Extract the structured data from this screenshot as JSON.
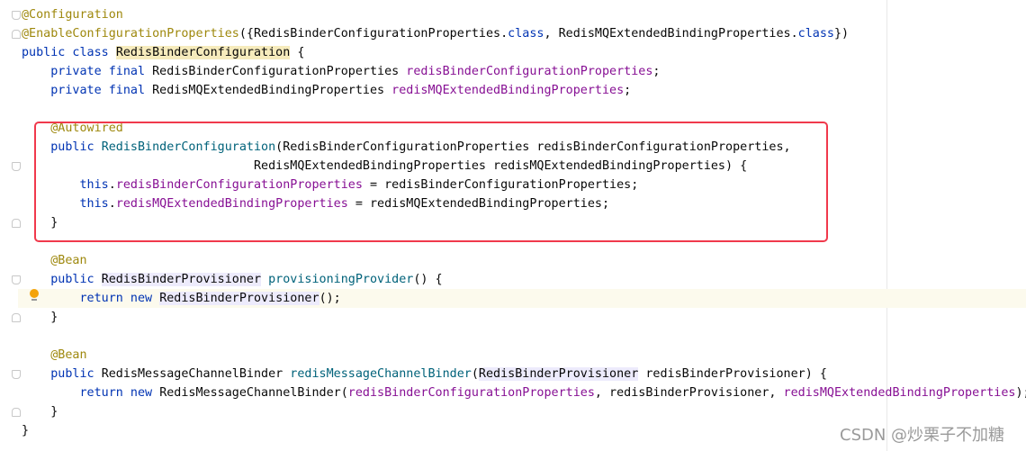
{
  "editor": {
    "lines": [
      [
        [
          "@Configuration",
          "ann"
        ]
      ],
      [
        [
          "@EnableConfigurationProperties",
          "ann"
        ],
        [
          "({RedisBinderConfigurationProperties.",
          ""
        ],
        [
          "class",
          "kw"
        ],
        [
          ", RedisMQExtendedBindingProperties.",
          ""
        ],
        [
          "class",
          "kw"
        ],
        [
          "})",
          ""
        ]
      ],
      [
        [
          "public class ",
          "kw"
        ],
        [
          "RedisBinderConfiguration",
          "hly"
        ],
        [
          " {",
          ""
        ]
      ],
      [
        [
          "    ",
          ""
        ],
        [
          "private final ",
          "kw"
        ],
        [
          "RedisBinderConfigurationProperties ",
          ""
        ],
        [
          "redisBinderConfigurationProperties",
          "fld"
        ],
        [
          ";",
          ""
        ]
      ],
      [
        [
          "    ",
          ""
        ],
        [
          "private final ",
          "kw"
        ],
        [
          "RedisMQExtendedBindingProperties ",
          ""
        ],
        [
          "redisMQExtendedBindingProperties",
          "fld"
        ],
        [
          ";",
          ""
        ]
      ],
      [],
      [
        [
          "    ",
          ""
        ],
        [
          "@Autowired",
          "ann"
        ]
      ],
      [
        [
          "    ",
          ""
        ],
        [
          "public ",
          "kw"
        ],
        [
          "RedisBinderConfiguration",
          "mth"
        ],
        [
          "(RedisBinderConfigurationProperties redisBinderConfigurationProperties,",
          ""
        ]
      ],
      [
        [
          "                                RedisMQExtendedBindingProperties redisMQExtendedBindingProperties) {",
          ""
        ]
      ],
      [
        [
          "        ",
          ""
        ],
        [
          "this",
          "kw"
        ],
        [
          ".",
          ""
        ],
        [
          "redisBinderConfigurationProperties",
          "fld"
        ],
        [
          " = redisBinderConfigurationProperties;",
          ""
        ]
      ],
      [
        [
          "        ",
          ""
        ],
        [
          "this",
          "kw"
        ],
        [
          ".",
          ""
        ],
        [
          "redisMQExtendedBindingProperties",
          "fld"
        ],
        [
          " = redisMQExtendedBindingProperties;",
          ""
        ]
      ],
      [
        [
          "    }",
          ""
        ]
      ],
      [],
      [
        [
          "    ",
          ""
        ],
        [
          "@Bean",
          "ann"
        ]
      ],
      [
        [
          "    ",
          ""
        ],
        [
          "public ",
          "kw"
        ],
        [
          "RedisBinderProvisioner",
          "hlv"
        ],
        [
          " ",
          ""
        ],
        [
          "provisioningProvider",
          "mth"
        ],
        [
          "() {",
          ""
        ]
      ],
      [
        [
          "        ",
          ""
        ],
        [
          "return new ",
          "kw"
        ],
        [
          "RedisBinderProvisioner",
          "hlv"
        ],
        [
          "();",
          ""
        ]
      ],
      [
        [
          "    }",
          ""
        ]
      ],
      [],
      [
        [
          "    ",
          ""
        ],
        [
          "@Bean",
          "ann"
        ]
      ],
      [
        [
          "    ",
          ""
        ],
        [
          "public ",
          "kw"
        ],
        [
          "RedisMessageChannelBinder ",
          ""
        ],
        [
          "redisMessageChannelBinder",
          "mth"
        ],
        [
          "(",
          ""
        ],
        [
          "RedisBinderProvisioner",
          "hlv"
        ],
        [
          " redisBinderProvisioner) {",
          ""
        ]
      ],
      [
        [
          "        ",
          ""
        ],
        [
          "return new ",
          "kw"
        ],
        [
          "RedisMessageChannelBinder(",
          ""
        ],
        [
          "redisBinderConfigurationProperties",
          "fld"
        ],
        [
          ", redisBinderProvisioner, ",
          ""
        ],
        [
          "redisMQExtendedBindingProperties",
          "fld"
        ],
        [
          ");",
          ""
        ]
      ],
      [
        [
          "    }",
          ""
        ]
      ],
      [
        [
          "}",
          ""
        ]
      ]
    ],
    "current_line": 15,
    "icons": {
      "intention": "lightbulb-icon",
      "fold": "fold-marker-icon"
    },
    "colors": {
      "annotation": "#9e880d",
      "keyword": "#0033b3",
      "field": "#871094",
      "method": "#00627a",
      "highlight_box": "#f0394c"
    }
  },
  "watermark": "CSDN @炒栗子不加糖"
}
